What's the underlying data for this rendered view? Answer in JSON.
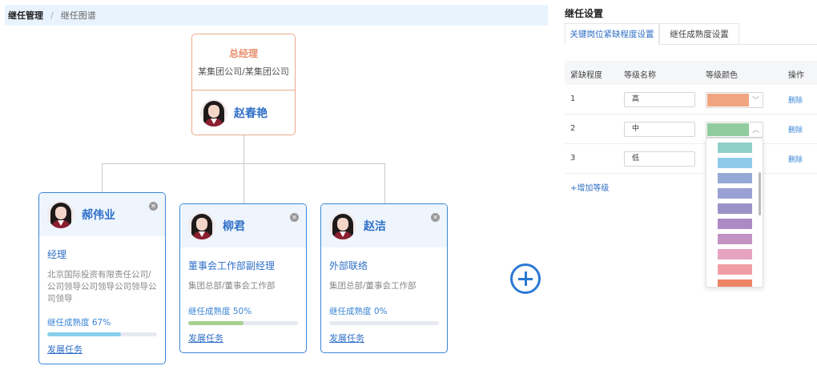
{
  "breadcrumb": {
    "root": "继任管理",
    "separator": "/",
    "current": "继任图谱"
  },
  "top_node": {
    "position": "总经理",
    "org": "某集团公司/某集团公司",
    "person": "赵春艳"
  },
  "nodes": [
    {
      "name": "郝伟业",
      "job": "经理",
      "dept": "北京国际投资有限责任公司/公司领导公司领导公司领导公司领导",
      "maturity_label": "继任成熟度 67%",
      "maturity": 0.67,
      "bar_color": "#87ceeb",
      "task": "发展任务"
    },
    {
      "name": "柳君",
      "job": "董事会工作部副经理",
      "dept": "集团总部/董事会工作部",
      "maturity_label": "继任成熟度 50%",
      "maturity": 0.5,
      "bar_color": "#a8d08d",
      "task": "发展任务"
    },
    {
      "name": "赵洁",
      "job": "外部联络",
      "dept": "集团总部/董事会工作部",
      "maturity_label": "继任成熟度 0%",
      "maturity": 0,
      "bar_color": "#87ceeb",
      "task": "发展任务"
    }
  ],
  "settings": {
    "title": "继任设置",
    "tabs": [
      {
        "label": "关键岗位紧缺程度设置"
      },
      {
        "label": "继任成熟度设置"
      }
    ],
    "headers": {
      "level": "紧缺程度",
      "name": "等级名称",
      "color": "等级颜色",
      "op": "操作"
    },
    "rows": [
      {
        "level": "1",
        "name": "高",
        "color": "#f0a580",
        "chevron": "﹀",
        "delete": "删除"
      },
      {
        "level": "2",
        "name": "中",
        "color": "#91cc9e",
        "chevron": "︿",
        "delete": "删除"
      },
      {
        "level": "3",
        "name": "低",
        "color": "",
        "chevron": "",
        "delete": "删除"
      }
    ],
    "add_level": "+增加等级",
    "palette": [
      "#8fd0c8",
      "#8ecbea",
      "#94a9d6",
      "#9aa0d3",
      "#9a93c7",
      "#ad8ac4",
      "#c393c4",
      "#e6a3c2",
      "#ef9ea5",
      "#ee8466"
    ]
  },
  "colors": {
    "accent": "#2f6fc7",
    "top_border": "#eba98c",
    "card_border": "#3a86d6"
  }
}
